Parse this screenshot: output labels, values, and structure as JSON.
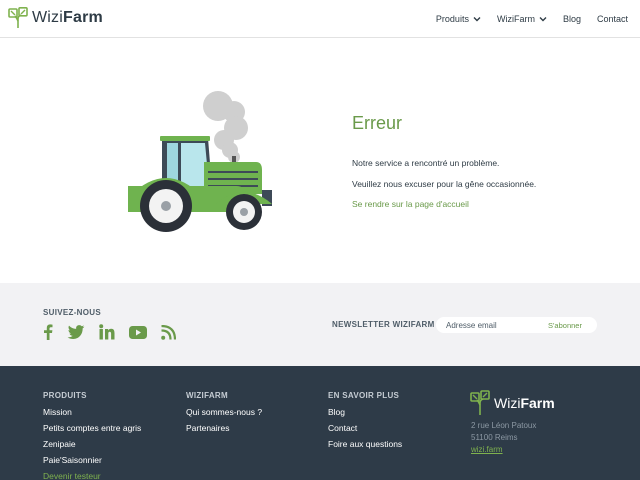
{
  "header": {
    "logo": {
      "text_plain": "Wizi",
      "text_bold": "Farm"
    },
    "nav": [
      {
        "label": "Produits",
        "has_dropdown": true
      },
      {
        "label": "WiziFarm",
        "has_dropdown": true
      },
      {
        "label": "Blog",
        "has_dropdown": false
      },
      {
        "label": "Contact",
        "has_dropdown": false
      }
    ]
  },
  "error": {
    "title": "Erreur",
    "line1": "Notre service a rencontré un problème.",
    "line2": "Veuillez nous excuser pour la gêne occasionnée.",
    "home_link": "Se rendre sur la page d'accueil"
  },
  "social": {
    "title": "SUIVEZ-NOUS",
    "icons": [
      "facebook-icon",
      "twitter-icon",
      "linkedin-icon",
      "youtube-icon",
      "rss-icon"
    ]
  },
  "newsletter": {
    "title": "NEWSLETTER WIZIFARM",
    "placeholder": "Adresse email",
    "button": "S'abonner"
  },
  "footer": {
    "col1": {
      "title": "PRODUITS",
      "links": [
        "Mission",
        "Petits comptes entre agris",
        "Zenipaie",
        "Paie'Saisonnier",
        "Devenir testeur"
      ]
    },
    "col2": {
      "title": "WIZIFARM",
      "links": [
        "Qui sommes-nous ?",
        "Partenaires"
      ]
    },
    "col3": {
      "title": "EN SAVOIR PLUS",
      "links": [
        "Blog",
        "Contact",
        "Foire aux questions"
      ]
    },
    "logo": {
      "text_plain": "Wizi",
      "text_bold": "Farm"
    },
    "address": {
      "street": "2 rue Léon Patoux",
      "city": "51100 Reims",
      "site": "wizi.farm"
    }
  },
  "colors": {
    "brand_green": "#6a9a4a",
    "footer_bg": "#2e3b48",
    "band_bg": "#f2f2f4",
    "text_dark": "#2e3b45"
  }
}
